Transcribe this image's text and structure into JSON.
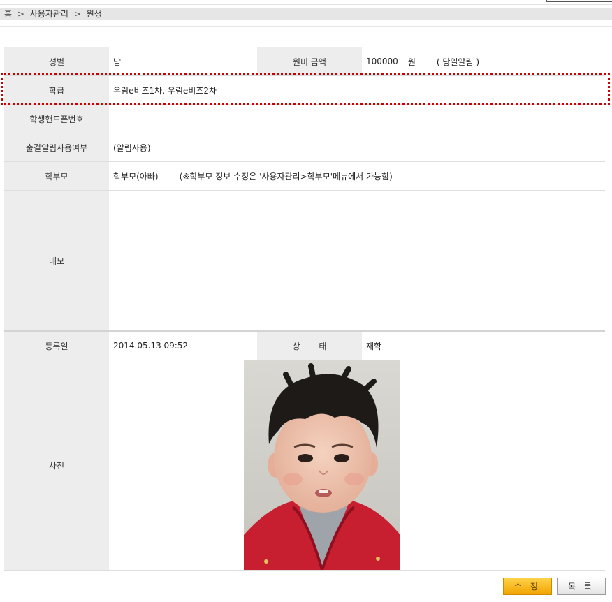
{
  "breadcrumb": {
    "home": "홈",
    "sep1": ">",
    "section": "사용자관리",
    "sep2": ">",
    "page": "원생"
  },
  "fields": {
    "gender": {
      "label": "성별",
      "value": "남"
    },
    "fee": {
      "label": "원비 금액",
      "amount": "100000",
      "unit": "원",
      "note": "( 당일알림 )"
    },
    "class": {
      "label": "학급",
      "value": "우림e비즈1차, 우림e비즈2차"
    },
    "phone": {
      "label": "학생핸드폰번호",
      "value": ""
    },
    "attendance_alert": {
      "label": "출결알림사용여부",
      "value": "(알림사용)"
    },
    "parent": {
      "label": "학부모",
      "value": "학부모(아빠)",
      "note": "(※학부모 정보 수정은 '사용자관리>학부모'메뉴에서 가능함)"
    },
    "memo": {
      "label": "메모",
      "value": ""
    },
    "registered": {
      "label": "등록일",
      "value": "2014.05.13 09:52"
    },
    "status": {
      "label": "상       태",
      "value": "재학"
    },
    "photo": {
      "label": "사진"
    }
  },
  "buttons": {
    "edit": "수 정",
    "list": "목 록"
  },
  "colors": {
    "highlight_border": "#cc0000",
    "edit_button": "#f0a400"
  }
}
